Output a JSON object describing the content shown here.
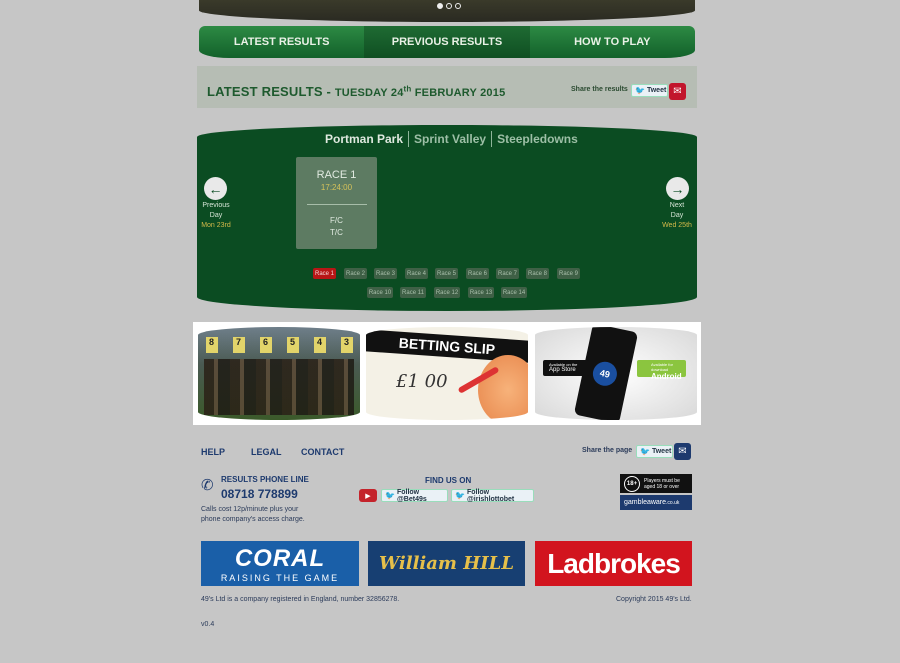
{
  "hero": {
    "dots": [
      true,
      false,
      false
    ]
  },
  "nav": {
    "tabs": [
      "LATEST RESULTS",
      "PREVIOUS RESULTS",
      "HOW TO PLAY"
    ]
  },
  "results_header": {
    "title_prefix": "LATEST RESULTS",
    "dash": "-",
    "date_day": "TUESDAY 24",
    "date_suffix": "th",
    "date_rest": "FEBRUARY 2015",
    "share_label": "Share the results",
    "tweet_label": "Tweet"
  },
  "courses": {
    "items": [
      "Portman Park",
      "Sprint Valley",
      "Steepledowns"
    ],
    "active_color": "#dfe9df",
    "inactive_color": "#9dbfa6"
  },
  "day_nav": {
    "prev": {
      "line1": "Previous",
      "line2": "Day",
      "date": "Mon 23rd"
    },
    "next": {
      "line1": "Next",
      "line2": "Day",
      "date": "Wed 25th"
    }
  },
  "race": {
    "title": "RACE 1",
    "time": "17:24:00",
    "fc": "F/C",
    "tc": "T/C"
  },
  "race_buttons": {
    "row1": [
      "Race 1",
      "Race 2",
      "Race 3",
      "Race 4",
      "Race 5",
      "Race 6",
      "Race 7",
      "Race 8",
      "Race 9"
    ],
    "row2": [
      "Race 10",
      "Race 11",
      "Race 12",
      "Race 13",
      "Race 14"
    ],
    "active": "Race 1"
  },
  "promos": {
    "betting_slip_title": "BETTING SLIP",
    "betting_slip_amount": "£1 00",
    "starting_gate_numbers": [
      "8",
      "7",
      "6",
      "5",
      "4",
      "3"
    ],
    "app_store_top": "Available on the",
    "app_store_label": "App Store",
    "android_top": "Available for download",
    "android_label": "Android",
    "phone_logo": "49"
  },
  "footer": {
    "links": [
      "HELP",
      "LEGAL",
      "CONTACT"
    ],
    "share_label": "Share the page",
    "tweet_label": "Tweet",
    "phone_title": "RESULTS PHONE LINE",
    "phone_number": "08718 778899",
    "phone_note": "Calls cost 12p/minute plus your phone company's access charge.",
    "find_us": "FIND US ON",
    "follow1": "Follow @Bet49s",
    "follow2": "Follow @irishlottobet",
    "age_badge": "18+",
    "age_text": "Players must be aged 18 or over",
    "gambleaware": "gambleaware",
    "gambleaware_domain": ".co.uk",
    "company_text": "49's Ltd is a company registered in England, number 32856278.",
    "copyright": "Copyright 2015 49's Ltd.",
    "version": "v0.4"
  },
  "sponsors": {
    "coral": {
      "name": "CORAL",
      "tagline": "RAISING THE GAME",
      "color": "#1a5fa8"
    },
    "williamhill": {
      "name": "William HILL",
      "color": "#173f72"
    },
    "ladbrokes": {
      "name": "Ladbrokes",
      "color": "#d2141e"
    }
  },
  "colors": {
    "brand_green": "#0b4c22",
    "nav_green": "#1f7a39",
    "title_green": "#1e5a2e",
    "link_blue": "#1d3a6e"
  }
}
